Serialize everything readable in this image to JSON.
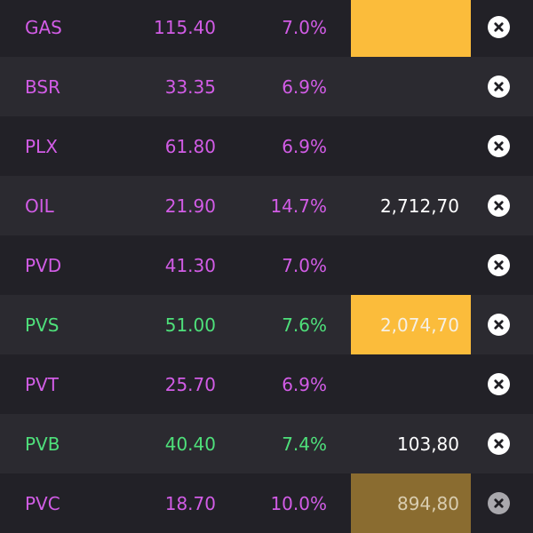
{
  "colors": {
    "ceiling": "#d25ce6",
    "up": "#4ee07a",
    "highlight": "#fbbc3b",
    "highlight_dim": "#8a6c30",
    "row_dark": "#222127",
    "row_light": "#2b2a30"
  },
  "rows": [
    {
      "symbol": "GAS",
      "price": "115.40",
      "change_pct": "7.0%",
      "volume": "",
      "color_state": "ceiling",
      "volume_highlight": "full",
      "close_icon": "close-circle-icon"
    },
    {
      "symbol": "BSR",
      "price": "33.35",
      "change_pct": "6.9%",
      "volume": "",
      "color_state": "ceiling",
      "volume_highlight": "none",
      "close_icon": "close-circle-icon"
    },
    {
      "symbol": "PLX",
      "price": "61.80",
      "change_pct": "6.9%",
      "volume": "",
      "color_state": "ceiling",
      "volume_highlight": "none",
      "close_icon": "close-circle-icon"
    },
    {
      "symbol": "OIL",
      "price": "21.90",
      "change_pct": "14.7%",
      "volume": "2,712,70",
      "color_state": "ceiling",
      "volume_highlight": "none",
      "close_icon": "close-circle-icon"
    },
    {
      "symbol": "PVD",
      "price": "41.30",
      "change_pct": "7.0%",
      "volume": "",
      "color_state": "ceiling",
      "volume_highlight": "none",
      "close_icon": "close-circle-icon"
    },
    {
      "symbol": "PVS",
      "price": "51.00",
      "change_pct": "7.6%",
      "volume": "2,074,70",
      "color_state": "up",
      "volume_highlight": "full",
      "close_icon": "close-circle-icon"
    },
    {
      "symbol": "PVT",
      "price": "25.70",
      "change_pct": "6.9%",
      "volume": "",
      "color_state": "ceiling",
      "volume_highlight": "none",
      "close_icon": "close-circle-icon"
    },
    {
      "symbol": "PVB",
      "price": "40.40",
      "change_pct": "7.4%",
      "volume": "103,80",
      "color_state": "up",
      "volume_highlight": "none",
      "close_icon": "close-circle-icon"
    },
    {
      "symbol": "PVC",
      "price": "18.70",
      "change_pct": "10.0%",
      "volume": "894,80",
      "color_state": "ceiling",
      "volume_highlight": "dim",
      "close_icon": "close-circle-icon"
    }
  ]
}
